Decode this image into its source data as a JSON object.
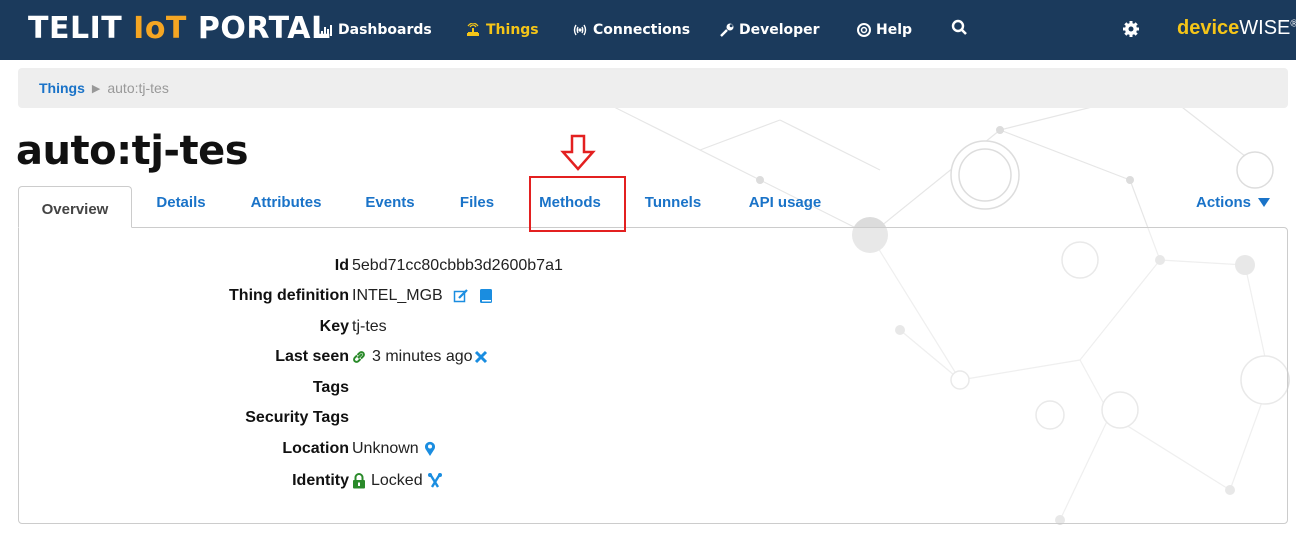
{
  "header": {
    "brand_main": "TELIT ",
    "brand_iot": "IoT",
    "brand_rest": " PORTAL",
    "nav": [
      {
        "label": "Dashboards",
        "icon": "bar-chart-icon"
      },
      {
        "label": "Things",
        "icon": "things-icon",
        "active": true
      },
      {
        "label": "Connections",
        "icon": "signal-icon"
      },
      {
        "label": "Developer",
        "icon": "wrench-icon"
      },
      {
        "label": "Help",
        "icon": "lifebuoy-icon"
      }
    ],
    "search_icon": "search-icon",
    "settings_icon": "gear-icon",
    "logo_device": "device",
    "logo_wise": "WISE",
    "logo_mark": "®"
  },
  "breadcrumb": {
    "root": "Things",
    "current": "auto:tj-tes"
  },
  "page": {
    "title": "auto:tj-tes"
  },
  "tabs": [
    {
      "label": "Overview",
      "active": true
    },
    {
      "label": "Details"
    },
    {
      "label": "Attributes"
    },
    {
      "label": "Events"
    },
    {
      "label": "Files"
    },
    {
      "label": "Methods",
      "highlighted": true
    },
    {
      "label": "Tunnels"
    },
    {
      "label": "API usage"
    }
  ],
  "actions_label": "Actions",
  "properties": {
    "id": {
      "label": "Id",
      "value": "5ebd71cc80cbbb3d2600b7a1"
    },
    "thing_definition": {
      "label": "Thing definition",
      "value": "INTEL_MGB"
    },
    "key": {
      "label": "Key",
      "value": "tj-tes"
    },
    "last_seen": {
      "label": "Last seen",
      "value": "3 minutes ago"
    },
    "tags": {
      "label": "Tags",
      "value": ""
    },
    "security_tags": {
      "label": "Security Tags",
      "value": ""
    },
    "location": {
      "label": "Location",
      "value": "Unknown"
    },
    "identity": {
      "label": "Identity",
      "value": "Locked"
    }
  },
  "colors": {
    "header_bg": "#1b3a5c",
    "accent": "#f5c518",
    "link": "#1a73c8",
    "highlight": "#e32020",
    "online_green": "#2a8a2a"
  }
}
